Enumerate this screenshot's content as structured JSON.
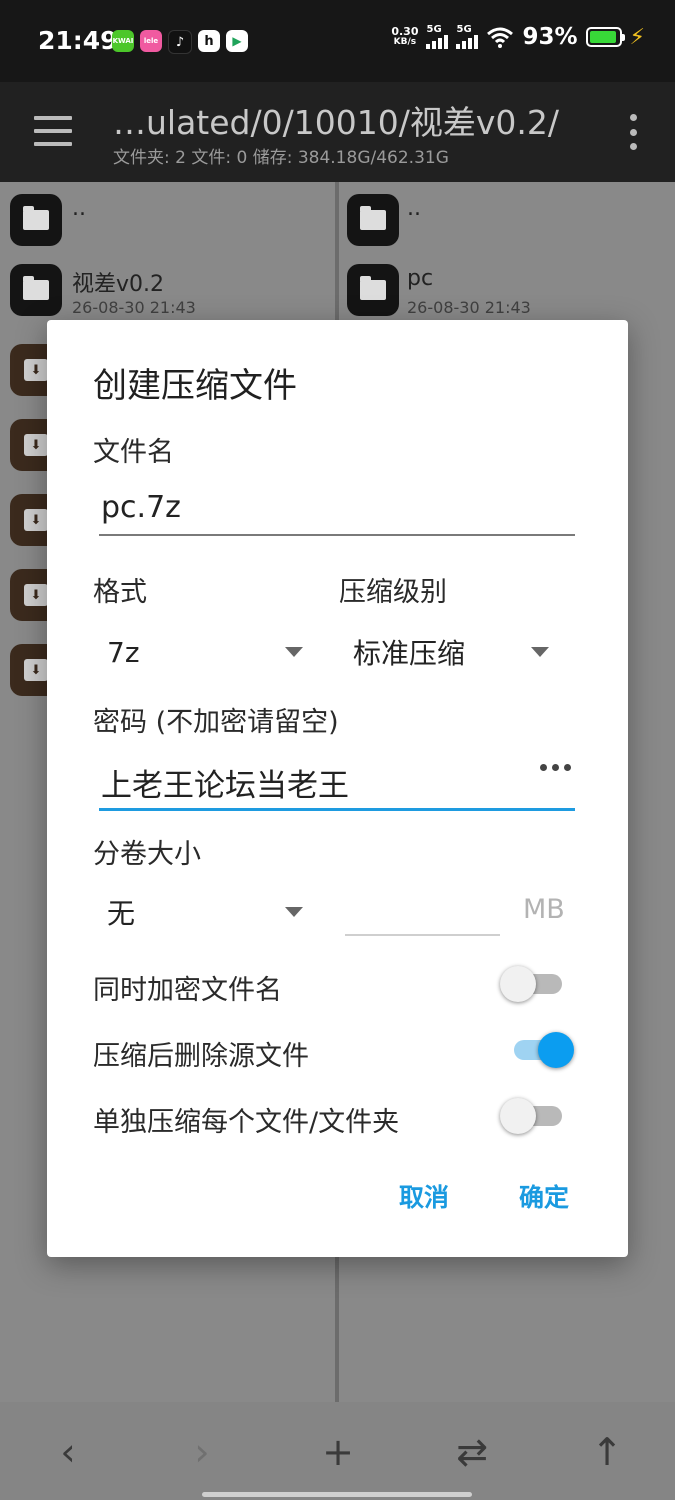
{
  "status_bar": {
    "time": "21:49",
    "net_speed_value": "0.30",
    "net_speed_unit": "KB/s",
    "signal1_label": "5G",
    "signal2_label": "5G",
    "battery_pct": "93%",
    "battery_level": 0.93,
    "battery_color": "#38d838",
    "app_icons": [
      {
        "name": "kwai-app-icon",
        "color": "#4cc72a",
        "text": "KWAI"
      },
      {
        "name": "lele-app-icon",
        "color": "#f05aa0",
        "text": "lele"
      },
      {
        "name": "tiktok-app-icon",
        "color": "#111111",
        "text": "♪"
      },
      {
        "name": "pinned-app-icon",
        "color": "#ffffff",
        "text": "h"
      },
      {
        "name": "play-app-icon",
        "color": "#ffffff",
        "text": "▶"
      }
    ]
  },
  "app_bar": {
    "path_title": "…ulated/0/10010/视差v0.2/",
    "path_info": "文件夹: 2  文件: 0  储存: 384.18G/462.31G"
  },
  "left_pane": {
    "items": [
      {
        "name": "..",
        "date": ""
      },
      {
        "name": "视差v0.2",
        "date": "26-08-30 21:43"
      }
    ]
  },
  "right_pane": {
    "items": [
      {
        "name": "..",
        "date": ""
      },
      {
        "name": "pc",
        "date": "26-08-30 21:43"
      }
    ]
  },
  "dialog": {
    "title": "创建压缩文件",
    "filename_label": "文件名",
    "filename_value": "pc.7z",
    "format_label": "格式",
    "format_value": "7z",
    "level_label": "压缩级别",
    "level_value": "标准压缩",
    "password_label": "密码 (不加密请留空)",
    "password_value": "上老王论坛当老王",
    "volume_label": "分卷大小",
    "volume_value": "无",
    "volume_size_value": "",
    "volume_unit": "MB",
    "encrypt_names_label": "同时加密文件名",
    "encrypt_names_on": false,
    "delete_source_label": "压缩后删除源文件",
    "delete_source_on": true,
    "separate_label": "单独压缩每个文件/文件夹",
    "separate_on": false,
    "cancel_label": "取消",
    "ok_label": "确定",
    "accent_color": "#1a9ae0"
  },
  "bottom_bar": {
    "back": "‹",
    "forward": "›",
    "add": "+",
    "swap": "⇄",
    "up": "↑"
  }
}
